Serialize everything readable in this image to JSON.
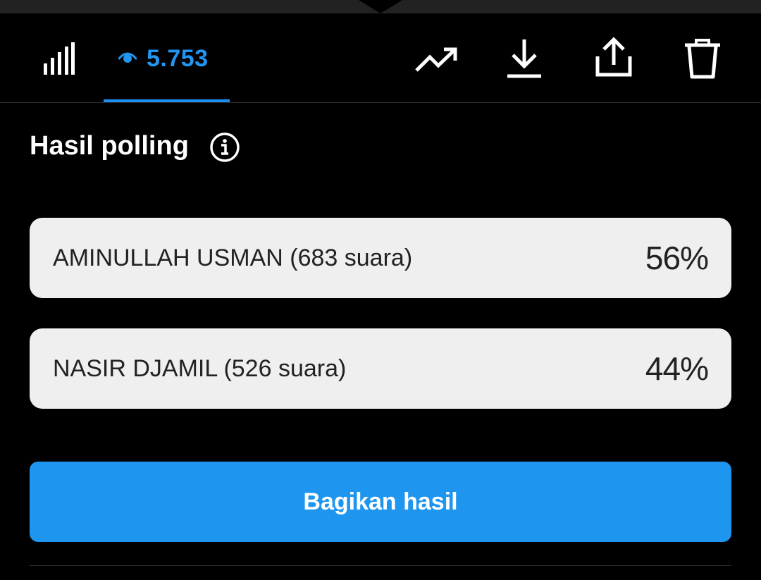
{
  "toolbar": {
    "views_count": "5.753",
    "icons": [
      "bar-chart-icon",
      "eye-icon",
      "trending-up-icon",
      "download-icon",
      "share-icon",
      "trash-icon"
    ],
    "accent_color": "#1f8ef1"
  },
  "poll": {
    "title": "Hasil polling",
    "options": [
      {
        "label": "AMINULLAH USMAN (683 suara)",
        "percent": "56%",
        "votes": 683
      },
      {
        "label": "NASIR DJAMIL (526 suara)",
        "percent": "44%",
        "votes": 526
      }
    ],
    "share_label": "Bagikan hasil",
    "share_color": "#1e96f0"
  }
}
